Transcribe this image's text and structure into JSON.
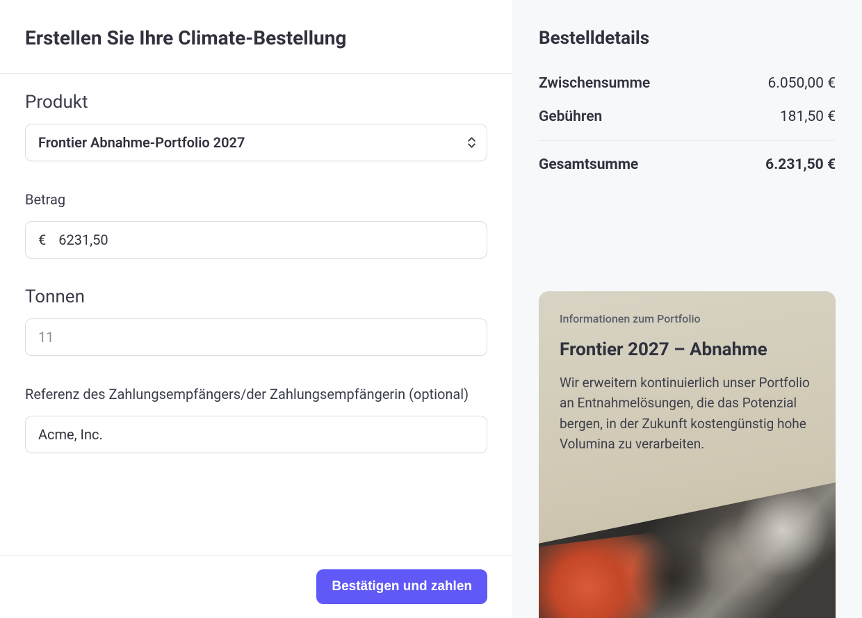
{
  "page": {
    "title": "Erstellen Sie Ihre Climate-Bestellung"
  },
  "form": {
    "product": {
      "label": "Produkt",
      "selected": "Frontier Abnahme-Portfolio 2027"
    },
    "amount": {
      "label": "Betrag",
      "currency": "€",
      "value": "6231,50"
    },
    "tons": {
      "label": "Tonnen",
      "placeholder": "11",
      "value": ""
    },
    "reference": {
      "label": "Referenz des Zahlungsempfängers/der Zahlungsempfängerin (optional)",
      "value": "Acme, Inc."
    },
    "submit_label": "Bestätigen und zahlen"
  },
  "order_details": {
    "title": "Bestelldetails",
    "subtotal": {
      "label": "Zwischensumme",
      "value": "6.050,00 €"
    },
    "fees": {
      "label": "Gebühren",
      "value": "181,50 €"
    },
    "total": {
      "label": "Gesamtsumme",
      "value": "6.231,50 €"
    }
  },
  "portfolio": {
    "eyebrow": "Informationen zum Portfolio",
    "title": "Frontier 2027 – Abnahme",
    "description": "Wir erweitern kontinuierlich unser Portfolio an Entnahmelösungen, die das Potenzial bergen, in der Zukunft kostengünstig hohe Volumina zu verarbeiten."
  }
}
